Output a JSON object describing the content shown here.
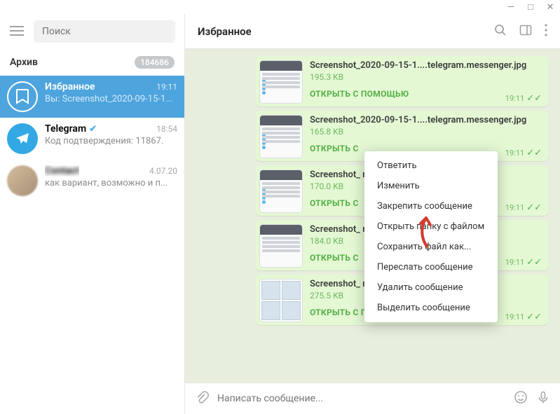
{
  "search_placeholder": "Поиск",
  "archive": {
    "label": "Архив",
    "count": "184686"
  },
  "chats": [
    {
      "name": "Избранное",
      "time": "19:11",
      "preview": "Вы: Screenshot_2020-09-15-1...",
      "kind": "saved",
      "selected": true
    },
    {
      "name": "Telegram",
      "time": "18:54",
      "preview": "Код подтверждения: 11867.",
      "kind": "telegram",
      "verified": true
    },
    {
      "name": "Contact",
      "time": "4.07.20",
      "preview": "как вариант, возможно и п...",
      "kind": "blurred"
    }
  ],
  "header_title": "Избранное",
  "messages": [
    {
      "file": "Screenshot_2020-09-15-1....telegram.messenger.jpg",
      "size": "195.3 KB",
      "open": "ОТКРЫТЬ С ПОМОЩЬЮ",
      "time": "19:11",
      "thumb": "app"
    },
    {
      "file": "Screenshot_2020-09-15-1....telegram.messenger.jpg",
      "size": "165.8 KB",
      "open": "ОТКРЫТЬ С",
      "time": "19:11",
      "thumb": "app"
    },
    {
      "file": "Screenshot_                                                          nger.jpg",
      "size": "170.0 KB",
      "open": "ОТКРЫТЬ С",
      "time": "19:11",
      "thumb": "app"
    },
    {
      "file": "Screenshot_                                                          nger.jpg",
      "size": "184.0 KB",
      "open": "ОТКРЫТЬ С",
      "time": "19:11",
      "thumb": "list"
    },
    {
      "file": "Screenshot_                                                          nger.jpg",
      "size": "275.5 KB",
      "open": "ОТКРЫТЬ С ПОМОЩЬЮ",
      "time": "19:11",
      "thumb": "collage"
    }
  ],
  "context_menu": {
    "items": [
      "Ответить",
      "Изменить",
      "Закрепить сообщение",
      "Открыть папку с файлом",
      "Сохранить файл как...",
      "Переслать сообщение",
      "Удалить сообщение",
      "Выделить сообщение"
    ]
  },
  "composer_placeholder": "Написать сообщение..."
}
